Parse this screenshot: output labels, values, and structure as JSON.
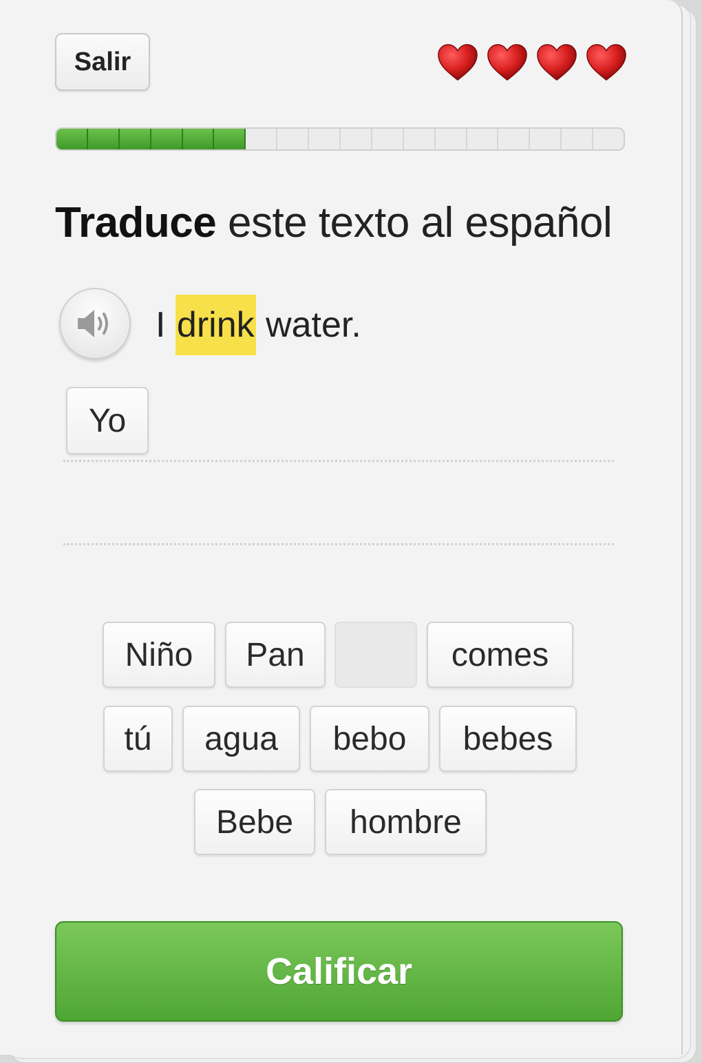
{
  "header": {
    "exit_label": "Salir",
    "hearts_remaining": 4,
    "heart_color": "#d81f1f"
  },
  "progress": {
    "completed_segments": 6,
    "total_segments": 18,
    "fill_color": "#4fa635"
  },
  "prompt": {
    "bold": "Traduce",
    "rest": " este texto al español"
  },
  "sentence": {
    "before": "I ",
    "highlight": "drink",
    "after": " water.",
    "highlight_color": "#f8e04a"
  },
  "answer": {
    "selected": [
      "Yo"
    ]
  },
  "word_bank": {
    "row1": [
      "Niño",
      "Pan",
      "",
      "comes"
    ],
    "row2": [
      "tú",
      "agua",
      "bebo",
      "bebes"
    ],
    "row3": [
      "Bebe",
      "hombre"
    ]
  },
  "submit_label": "Calificar",
  "accent_color": "#58ab3c"
}
